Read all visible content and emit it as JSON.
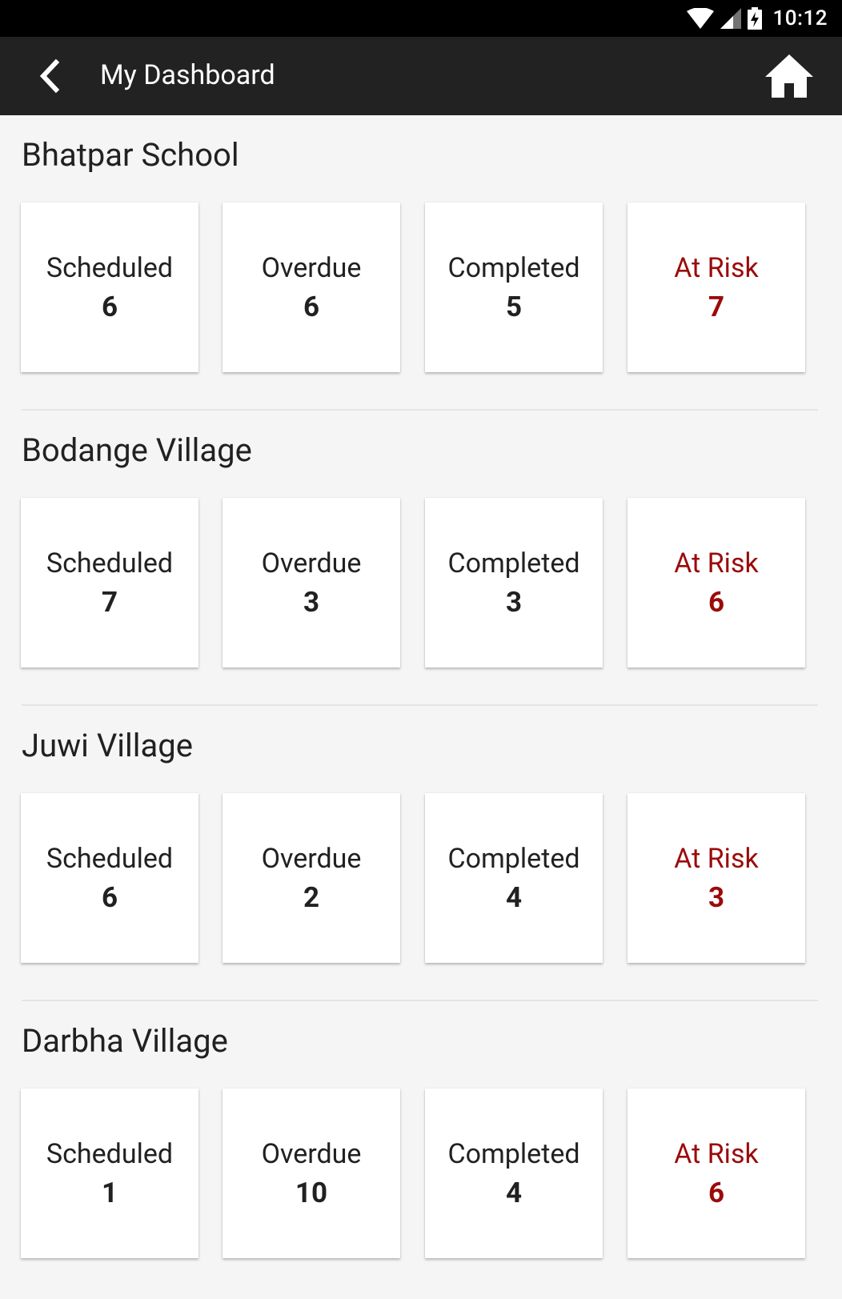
{
  "status_bar": {
    "time": "10:12",
    "icons": [
      "wifi-icon",
      "signal-icon",
      "battery-charging-icon"
    ]
  },
  "app_bar": {
    "title": "My Dashboard",
    "back_icon": "back-chevron-icon",
    "home_icon": "home-icon"
  },
  "colors": {
    "app_bar": "#222222",
    "status_bar": "#000000",
    "background": "#f5f5f5",
    "at_risk": "#9b0a0a",
    "text": "#212121"
  },
  "sections": [
    {
      "title": "Bhatpar School",
      "cards": [
        {
          "label": "Scheduled",
          "value": "6"
        },
        {
          "label": "Overdue",
          "value": "6"
        },
        {
          "label": "Completed",
          "value": "5"
        },
        {
          "label": "At Risk",
          "value": "7"
        }
      ]
    },
    {
      "title": "Bodange Village",
      "cards": [
        {
          "label": "Scheduled",
          "value": "7"
        },
        {
          "label": "Overdue",
          "value": "3"
        },
        {
          "label": "Completed",
          "value": "3"
        },
        {
          "label": "At Risk",
          "value": "6"
        }
      ]
    },
    {
      "title": "Juwi Village",
      "cards": [
        {
          "label": "Scheduled",
          "value": "6"
        },
        {
          "label": "Overdue",
          "value": "2"
        },
        {
          "label": "Completed",
          "value": "4"
        },
        {
          "label": "At Risk",
          "value": "3"
        }
      ]
    },
    {
      "title": "Darbha Village",
      "cards": [
        {
          "label": "Scheduled",
          "value": "1"
        },
        {
          "label": "Overdue",
          "value": "10"
        },
        {
          "label": "Completed",
          "value": "4"
        },
        {
          "label": "At Risk",
          "value": "6"
        }
      ]
    }
  ]
}
